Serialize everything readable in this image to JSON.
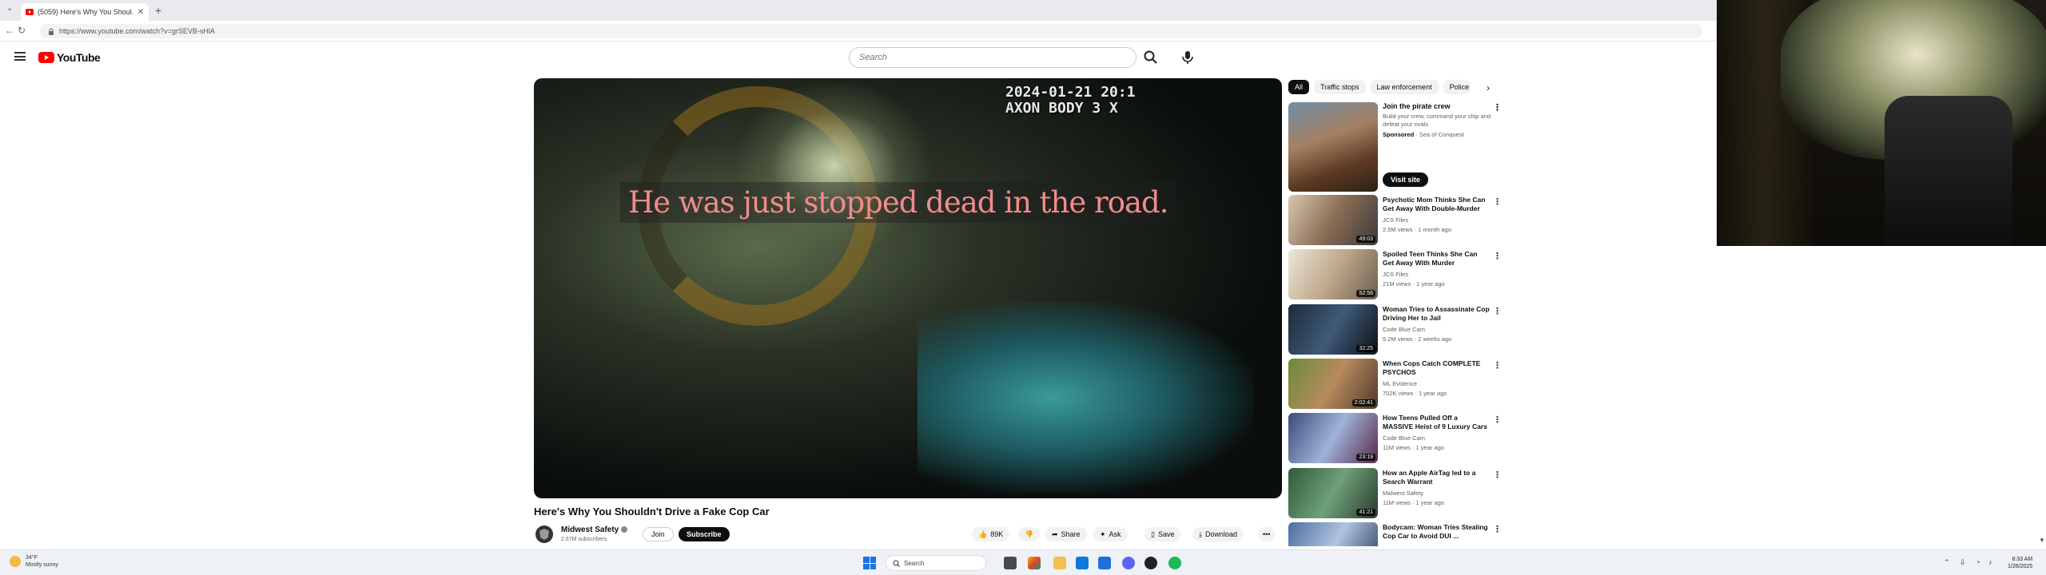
{
  "browser": {
    "tab_title": "(5059) Here's Why You Shoul...",
    "url": "https://www.youtube.com/watch?v=grSEVB-sHlA"
  },
  "masthead": {
    "logo_text": "YouTube",
    "search_placeholder": "Search"
  },
  "video": {
    "timestamp_line1": "2024-01-21 20:1",
    "timestamp_line2": "AXON BODY 3 X",
    "caption": "He was just stopped dead in the road.",
    "title": "Here's Why You Shouldn't Drive a Fake Cop Car",
    "channel_name": "Midwest Safety",
    "subscribers": "2.67M subscribers",
    "join_label": "Join",
    "subscribe_label": "Subscribe",
    "likes": "89K",
    "share_label": "Share",
    "ask_label": "Ask",
    "save_label": "Save",
    "download_label": "Download"
  },
  "sidebar": {
    "chips": [
      "All",
      "Traffic stops",
      "Law enforcement",
      "Police"
    ],
    "ad": {
      "title": "Join the pirate crew",
      "description": "Build your crew, command your ship and defeat your rivals",
      "sponsored": "Sponsored",
      "advertiser": "Sea of Conquest",
      "button": "Visit site"
    },
    "recommendations": [
      {
        "title": "Psychotic Mom Thinks She Can Get Away With Double-Murder",
        "channel": "JCS Files",
        "meta": "2.5M views · 1 month ago",
        "duration": "49:03"
      },
      {
        "title": "Spoiled Teen Thinks She Can Get Away With Murder",
        "channel": "JCS Files",
        "meta": "21M views · 1 year ago",
        "duration": "52:58"
      },
      {
        "title": "Woman Tries to Assassinate Cop Driving Her to Jail",
        "channel": "Code Blue Cam",
        "meta": "5.2M views · 2 weeks ago",
        "duration": "32:25"
      },
      {
        "title": "When Cops Catch COMPLETE PSYCHOS",
        "channel": "ML Evidence",
        "meta": "702K views · 1 year ago",
        "duration": "2:02:41"
      },
      {
        "title": "How Teens Pulled Off a MASSIVE Heist of 9 Luxury Cars",
        "channel": "Code Blue Cam",
        "meta": "11M views · 1 year ago",
        "duration": "23:19"
      },
      {
        "title": "How an Apple AirTag led to a Search Warrant",
        "channel": "Midwest Safety",
        "meta": "11M views · 1 year ago",
        "duration": "41:21"
      },
      {
        "title": "Bodycam: Woman Tries Stealing Cop Car to Avoid DUI ...",
        "channel": "",
        "meta": "",
        "duration": ""
      }
    ]
  },
  "taskbar": {
    "weather_temp": "34°F",
    "weather_desc": "Mostly sunny",
    "search_label": "Search",
    "time": "8:33 AM",
    "date": "1/26/2025"
  }
}
